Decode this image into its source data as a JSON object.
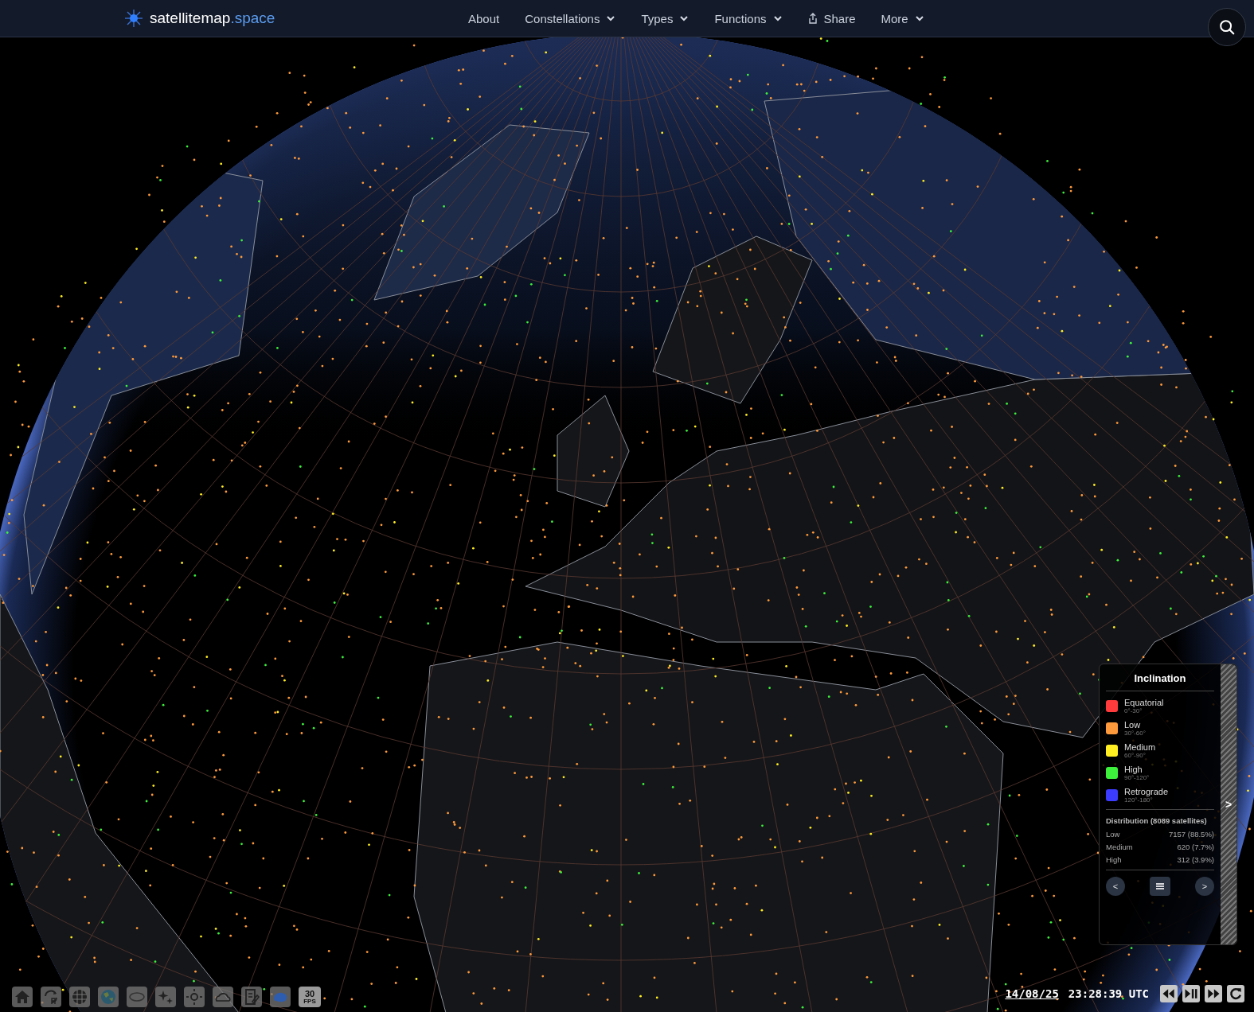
{
  "brand": {
    "name": "satellitemap",
    "suffix": ".space"
  },
  "nav": [
    {
      "label": "About",
      "kind": "link"
    },
    {
      "label": "Constellations",
      "kind": "dropdown"
    },
    {
      "label": "Types",
      "kind": "dropdown"
    },
    {
      "label": "Functions",
      "kind": "dropdown"
    },
    {
      "label": "Share",
      "kind": "share"
    },
    {
      "label": "More",
      "kind": "dropdown"
    }
  ],
  "legend": {
    "title": "Inclination",
    "items": [
      {
        "label": "Equatorial",
        "range": "0°-30°",
        "color": "#ff3b3b"
      },
      {
        "label": "Low",
        "range": "30°-60°",
        "color": "#ff9a3c"
      },
      {
        "label": "Medium",
        "range": "60°-90°",
        "color": "#ffee22"
      },
      {
        "label": "High",
        "range": "90°-120°",
        "color": "#3cf03c"
      },
      {
        "label": "Retrograde",
        "range": "120°-180°",
        "color": "#3c3cff"
      }
    ],
    "distribution_title": "Distribution (8089 satellites)",
    "distribution": [
      {
        "label": "Low",
        "value": "7157 (88.5%)"
      },
      {
        "label": "Medium",
        "value": "620 (7.7%)"
      },
      {
        "label": "High",
        "value": "312 (3.9%)"
      }
    ],
    "prev": "<",
    "next": ">",
    "collapse": ">"
  },
  "fps": {
    "value": "30",
    "unit": "FPS"
  },
  "time": {
    "date": "14/08/25",
    "clock": "23:28:39 UTC"
  }
}
